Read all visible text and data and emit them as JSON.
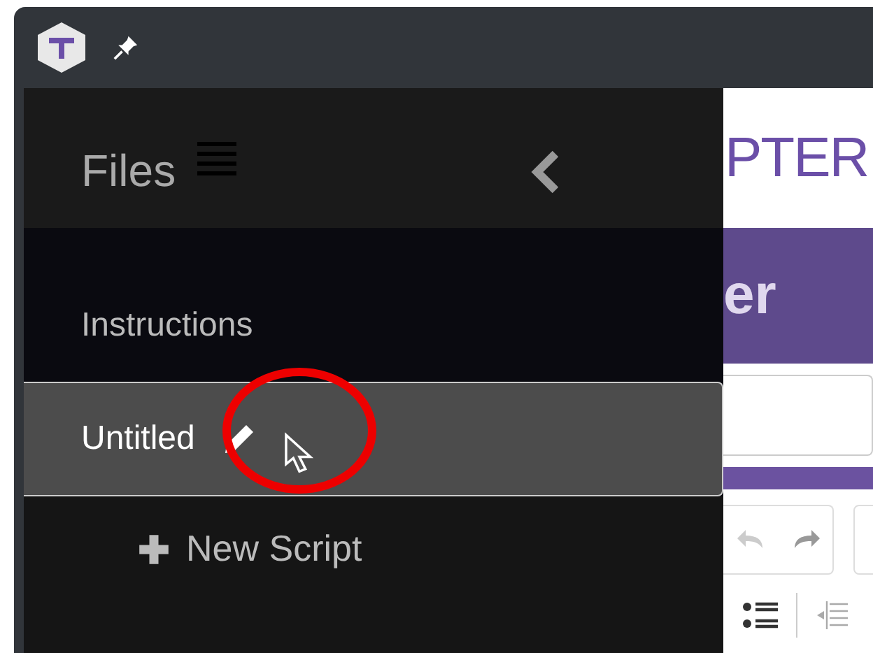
{
  "sidebar": {
    "title": "Files",
    "items": [
      {
        "label": "Instructions",
        "selected": false
      },
      {
        "label": "Untitled",
        "selected": true
      }
    ],
    "new_button": "New Script"
  },
  "page": {
    "logo": "PTER",
    "header": "er"
  }
}
